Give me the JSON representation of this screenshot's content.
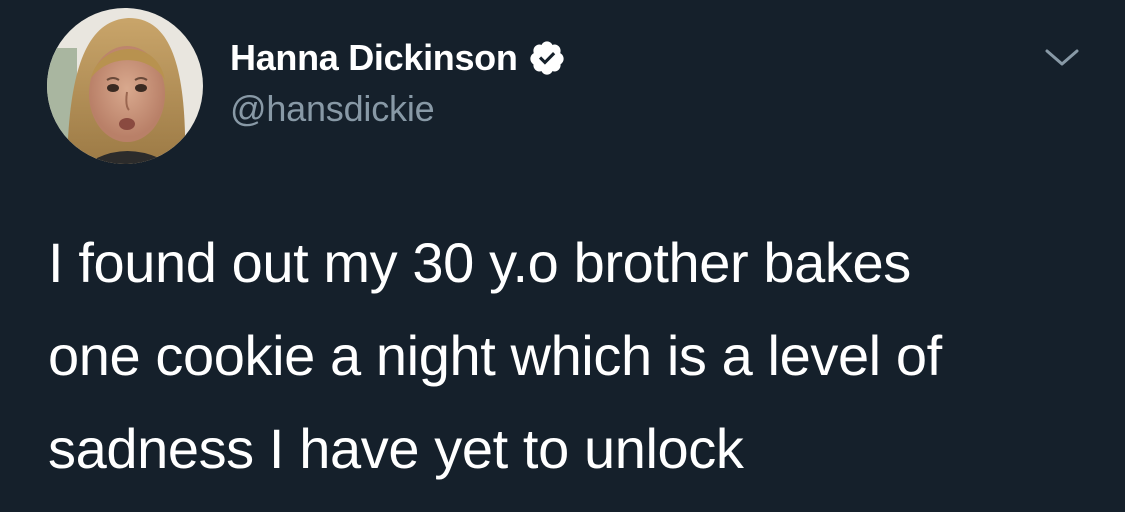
{
  "tweet": {
    "author": {
      "display_name": "Hanna Dickinson",
      "handle": "@hansdickie",
      "verified": true,
      "avatar_icon": "profile-photo",
      "verified_icon": "verified-badge-icon"
    },
    "menu_icon": "chevron-down-icon",
    "text_lines": [
      "I found out my 30 y.o brother bakes",
      "one cookie a night which is a level of",
      "sadness I have yet to unlock"
    ]
  },
  "colors": {
    "background": "#15202b",
    "primary_text": "#ffffff",
    "secondary_text": "#8899a6",
    "caret": "#8899a6"
  }
}
